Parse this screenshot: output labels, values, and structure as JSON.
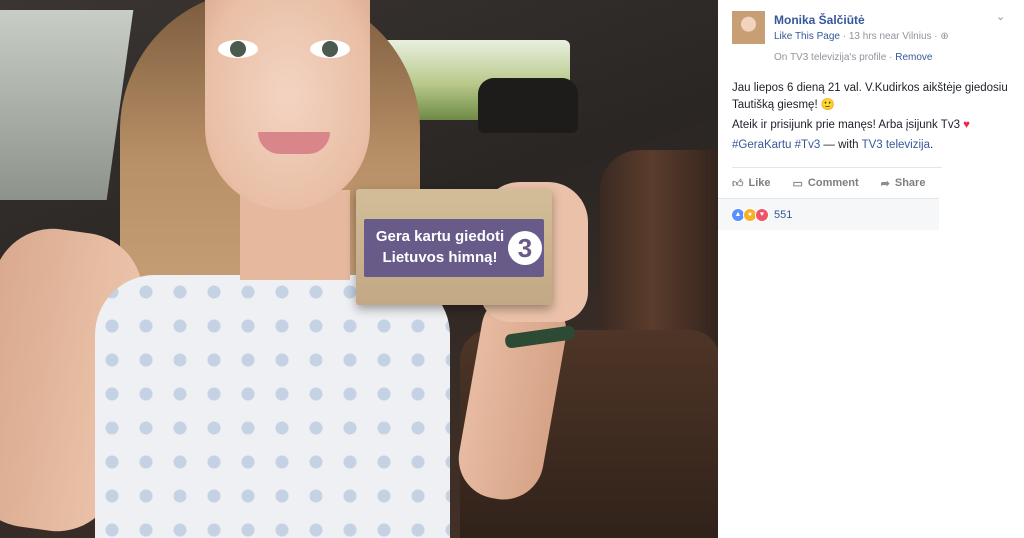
{
  "photo": {
    "box": {
      "line1": "Gera kartu giedoti",
      "line2": "Lietuvos himną!",
      "logo": "3"
    }
  },
  "post": {
    "author": "Monika Šalčiūtė",
    "like_page": "Like This Page",
    "separator": "·",
    "time_location": "13 hrs near Vilnius ·",
    "profile_note": "On TV3 televizija's profile ·",
    "remove": "Remove",
    "line1": "Jau liepos 6 dieną 21 val. V.Kudirkos aikštėje giedosiu Tautišką giesmę! 🙂",
    "line2": "Ateik ir prisijunk prie manęs! Arba įsijunk Tv3",
    "hashtags": "#GeraKartu #Tv3",
    "with_text": "— with",
    "with_page": "TV3 televizija",
    "period": "."
  },
  "actions": {
    "like": "Like",
    "comment": "Comment",
    "share": "Share"
  },
  "reactions": {
    "count": "551"
  },
  "icons": {
    "close": "chevron-down-icon",
    "like": "thumbs-up-icon",
    "comment": "comment-icon",
    "share": "share-icon"
  }
}
